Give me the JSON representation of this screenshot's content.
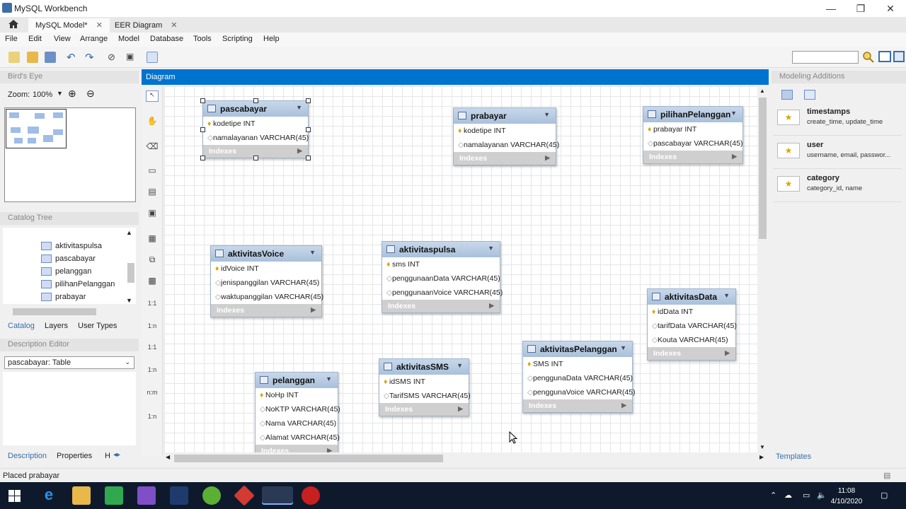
{
  "window": {
    "title": "MySQL Workbench",
    "minimize": "—",
    "maximize": "❐",
    "close": "✕"
  },
  "tabs": [
    {
      "label": "MySQL Model*",
      "close": "✕"
    },
    {
      "label": "EER Diagram",
      "close": "✕"
    }
  ],
  "menu": [
    "File",
    "Edit",
    "View",
    "Arrange",
    "Model",
    "Database",
    "Tools",
    "Scripting",
    "Help"
  ],
  "left": {
    "birds_eye": "Bird's Eye",
    "zoom_label": "Zoom:",
    "zoom_value": "100%",
    "catalog_tree": "Catalog Tree",
    "tree_items": [
      "aktivitaspulsa",
      "pascabayar",
      "pelanggan",
      "pilihanPelanggan",
      "prabayar"
    ],
    "tabs": [
      "Catalog",
      "Layers",
      "User Types"
    ],
    "description_editor": "Description Editor",
    "description_select": "pascabayar: Table",
    "bottom_tabs": [
      "Description",
      "Properties",
      "H"
    ]
  },
  "diagram": {
    "header": "Diagram"
  },
  "tables": [
    {
      "name": "pascabayar",
      "columns": [
        {
          "key": true,
          "text": "kodetipe INT"
        },
        {
          "key": false,
          "text": "namalayanan VARCHAR(45)"
        }
      ],
      "indexes": "Indexes"
    },
    {
      "name": "prabayar",
      "columns": [
        {
          "key": true,
          "text": "kodetipe INT"
        },
        {
          "key": false,
          "text": "namalayanan VARCHAR(45)"
        }
      ],
      "indexes": "Indexes"
    },
    {
      "name": "pilihanPelanggan",
      "columns": [
        {
          "key": true,
          "text": "prabayar INT"
        },
        {
          "key": false,
          "text": "pascabayar VARCHAR(45)"
        }
      ],
      "indexes": "Indexes"
    },
    {
      "name": "aktivitasVoice",
      "columns": [
        {
          "key": true,
          "text": "idVoice INT"
        },
        {
          "key": false,
          "text": "jenispanggilan VARCHAR(45)"
        },
        {
          "key": false,
          "text": "waktupanggilan VARCHAR(45)"
        }
      ],
      "indexes": "Indexes"
    },
    {
      "name": "aktivitaspulsa",
      "columns": [
        {
          "key": true,
          "text": "sms INT"
        },
        {
          "key": false,
          "text": "penggunaanData VARCHAR(45)"
        },
        {
          "key": false,
          "text": "penggunaanVoice VARCHAR(45)"
        }
      ],
      "indexes": "Indexes"
    },
    {
      "name": "aktivitasData",
      "columns": [
        {
          "key": true,
          "text": "idData INT"
        },
        {
          "key": false,
          "text": "tarifData VARCHAR(45)"
        },
        {
          "key": false,
          "text": "Kouta VARCHAR(45)"
        }
      ],
      "indexes": "Indexes"
    },
    {
      "name": "aktivitasPelanggan",
      "columns": [
        {
          "key": true,
          "text": "SMS INT"
        },
        {
          "key": false,
          "text": "penggunaData VARCHAR(45)"
        },
        {
          "key": false,
          "text": "penggunaVoice VARCHAR(45)"
        }
      ],
      "indexes": "Indexes"
    },
    {
      "name": "aktivitasSMS",
      "columns": [
        {
          "key": true,
          "text": "idSMS INT"
        },
        {
          "key": false,
          "text": "TarifSMS VARCHAR(45)"
        }
      ],
      "indexes": "Indexes"
    },
    {
      "name": "pelanggan",
      "columns": [
        {
          "key": true,
          "text": "NoHp INT"
        },
        {
          "key": false,
          "text": "NoKTP VARCHAR(45)"
        },
        {
          "key": false,
          "text": "Nama VARCHAR(45)"
        },
        {
          "key": false,
          "text": "Alamat VARCHAR(45)"
        }
      ],
      "indexes": "Indexes"
    }
  ],
  "palette": {
    "rel_1_1": "1:1",
    "rel_1_n": "1:n",
    "rel_1_1b": "1:1",
    "rel_1_nb": "1:n",
    "rel_n_m": "n:m",
    "rel_1_nc": "1:n"
  },
  "right": {
    "header": "Modeling Additions",
    "snippets": [
      {
        "name": "timestamps",
        "desc": "create_time, update_time"
      },
      {
        "name": "user",
        "desc": "username, email, passwor..."
      },
      {
        "name": "category",
        "desc": "category_id, name"
      }
    ],
    "templates": "Templates"
  },
  "status": "Placed prabayar",
  "clock": {
    "time": "11:08",
    "date": "4/10/2020"
  },
  "colors": {
    "diagram_header": "#0073cf",
    "table_header": "#b8cce4",
    "taskbar": "#0e1a2c"
  }
}
